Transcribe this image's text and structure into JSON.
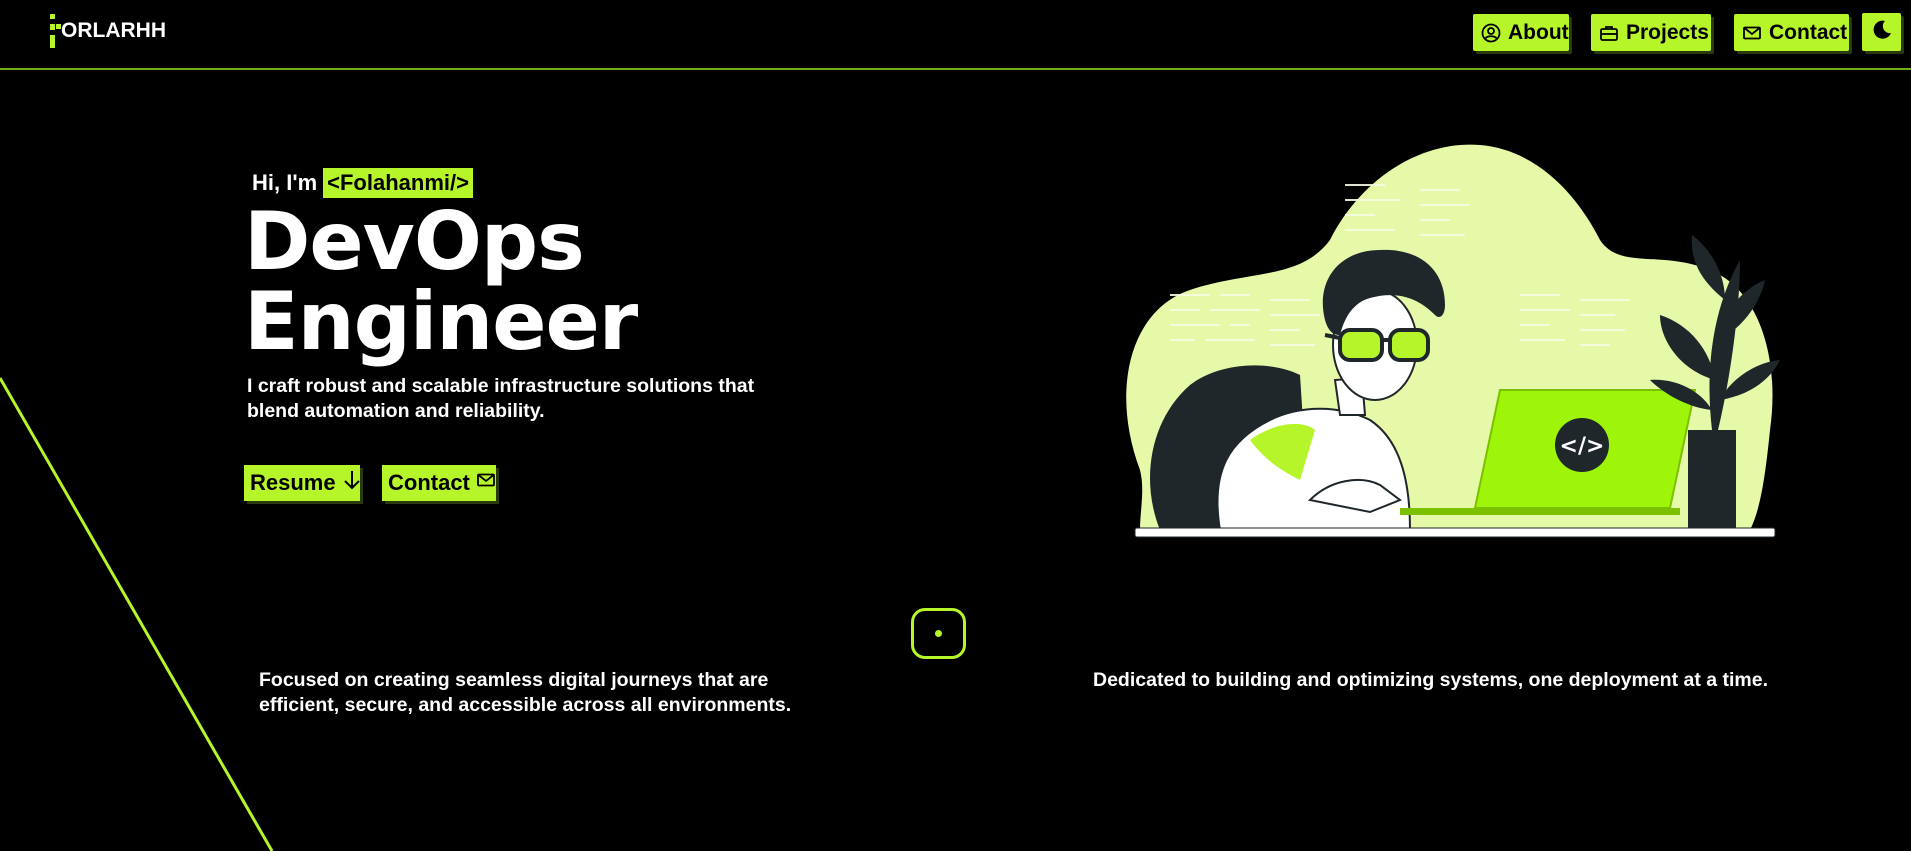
{
  "header": {
    "logo_text": "ORLARHH",
    "nav": [
      {
        "label": "About",
        "icon": "user-circle-icon"
      },
      {
        "label": "Projects",
        "icon": "briefcase-icon"
      },
      {
        "label": "Contact",
        "icon": "mail-icon"
      }
    ],
    "theme_toggle_icon": "moon-icon"
  },
  "hero": {
    "greeting": "Hi, I'm",
    "name": "<Folahanmi/>",
    "role_line1": "DevOps",
    "role_line2": "Engineer",
    "tagline": "I craft robust and scalable infrastructure solutions that blend automation and reliability.",
    "resume_label": "Resume",
    "resume_icon": "arrow-down-icon",
    "contact_label": "Contact",
    "contact_icon": "mail-icon"
  },
  "illustration": {
    "laptop_code_glyph": "</>",
    "description_icon": "developer-at-laptop-illustration"
  },
  "blurbs": {
    "left": "Focused on creating seamless digital journeys that are efficient, secure, and accessible across all environments.",
    "right": "Dedicated to building and optimizing systems, one deployment at a time."
  },
  "colors": {
    "accent": "#b7f52b",
    "background": "#000000",
    "text": "#ffffff",
    "illustration_light": "#e6f9a8",
    "illustration_dark": "#1f272b"
  }
}
